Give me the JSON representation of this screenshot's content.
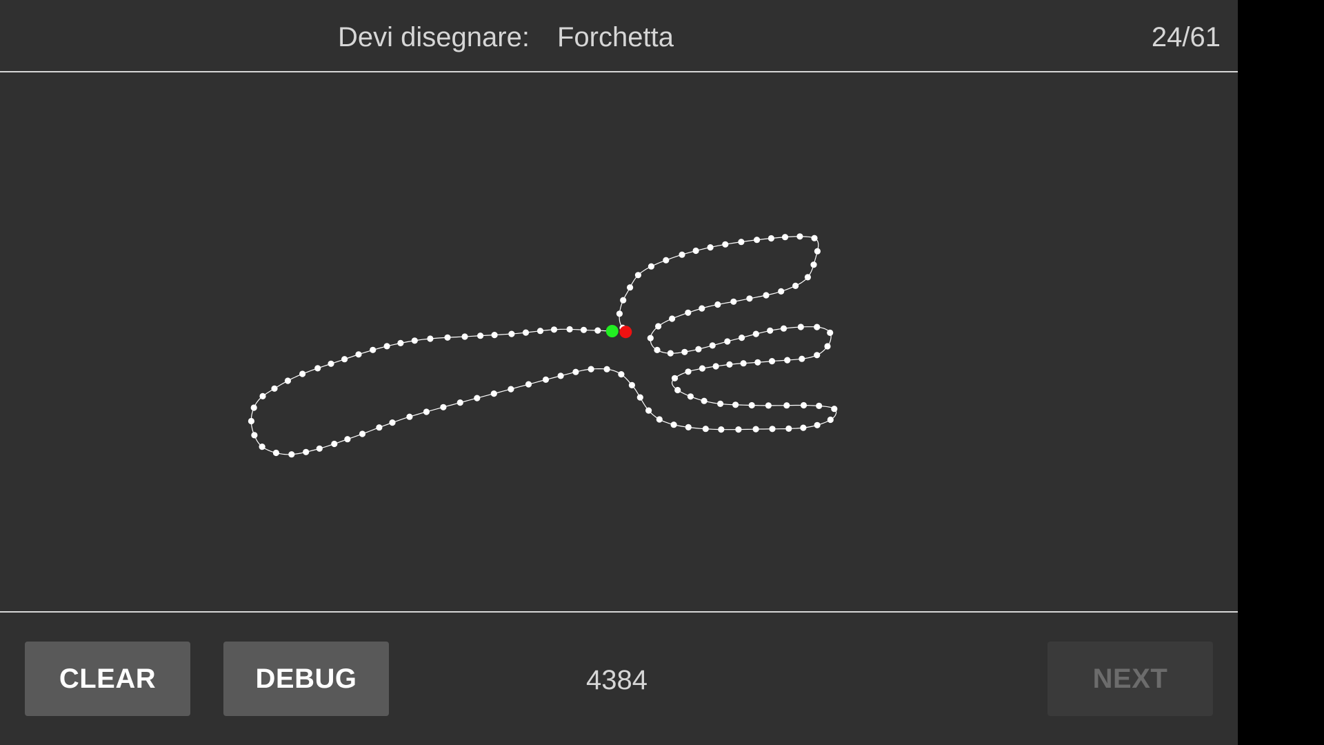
{
  "header": {
    "prompt_label": "Devi disegnare:",
    "prompt_word": "Forchetta",
    "counter": "24/61"
  },
  "drawing": {
    "stroke_color": "#ffffff",
    "start_marker_color": "#22ee22",
    "end_marker_color": "#ee1111"
  },
  "footer": {
    "clear_label": "CLEAR",
    "debug_label": "DEBUG",
    "score": "4384",
    "next_label": "NEXT",
    "next_enabled": false
  },
  "colors": {
    "background": "#303030",
    "divider": "#d8d8d8",
    "button": "#595959",
    "button_disabled": "#3a3a3a"
  }
}
